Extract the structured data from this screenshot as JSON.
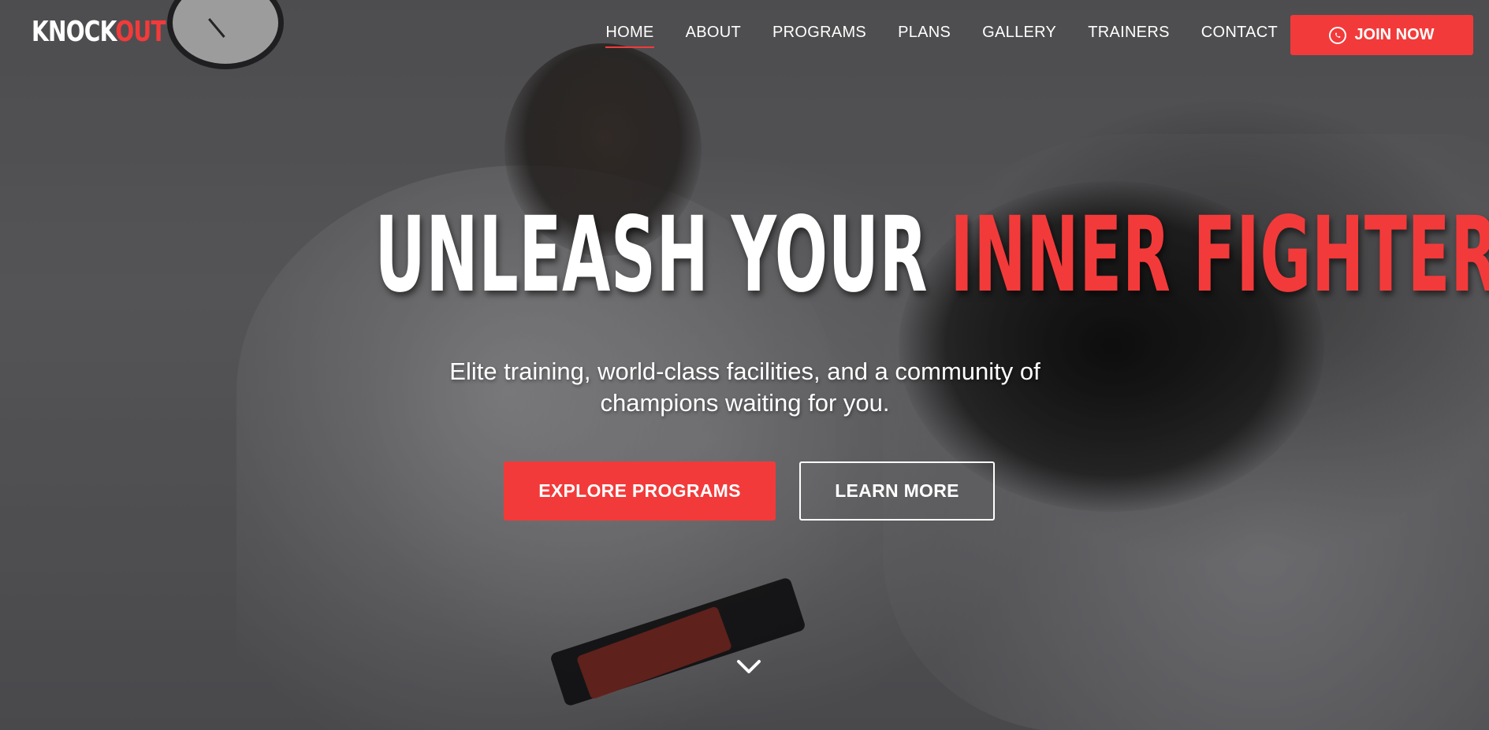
{
  "brand": {
    "logo_main": "KNOCK",
    "logo_accent": "OUT"
  },
  "nav": {
    "items": [
      {
        "label": "HOME",
        "active": true
      },
      {
        "label": "ABOUT",
        "active": false
      },
      {
        "label": "PROGRAMS",
        "active": false
      },
      {
        "label": "PLANS",
        "active": false
      },
      {
        "label": "GALLERY",
        "active": false
      },
      {
        "label": "TRAINERS",
        "active": false
      },
      {
        "label": "CONTACT",
        "active": false
      }
    ],
    "cta_label": "JOIN NOW",
    "cta_icon": "whatsapp-icon"
  },
  "hero": {
    "headline_white": "UNLEASH YOUR ",
    "headline_red": "INNER FIGHTER",
    "subtitle_line1": "Elite training, world-class facilities, and a community of",
    "subtitle_line2": "champions waiting for you.",
    "primary_button": "EXPLORE PROGRAMS",
    "secondary_button": "LEARN MORE",
    "scroll_icon": "chevron-down-icon"
  },
  "colors": {
    "accent": "#f33a3a",
    "text": "#ffffff"
  }
}
